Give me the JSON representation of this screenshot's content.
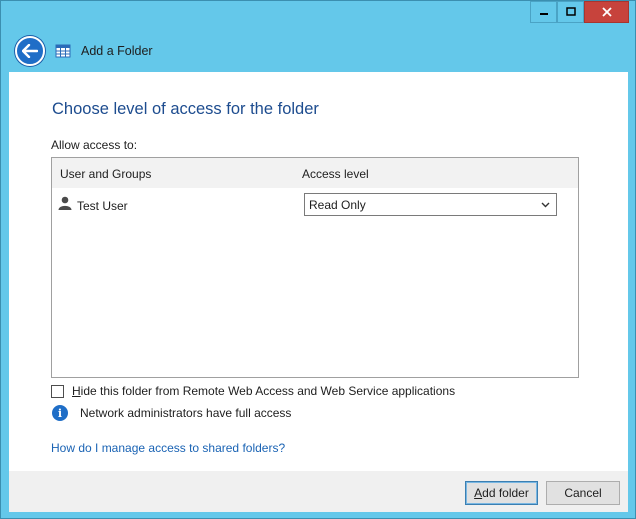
{
  "window": {
    "title": "Add a Folder",
    "caption_buttons": [
      "minimize",
      "maximize",
      "close"
    ]
  },
  "page": {
    "heading": "Choose level of access for the folder",
    "allow_label": "Allow access to:",
    "columns": [
      "User and Groups",
      "Access level"
    ],
    "rows": [
      {
        "name": "Test User",
        "access": "Read Only",
        "icon": "user-icon"
      }
    ],
    "hide_checkbox": {
      "label_prefix": "",
      "label_underlined": "H",
      "label_rest": "ide this folder from Remote Web Access and Web Service applications",
      "checked": false
    },
    "info_text": "Network administrators have full access",
    "help_link": "How do I manage access to shared folders?"
  },
  "footer": {
    "add_folder_underlined": "A",
    "add_folder_rest": "dd folder",
    "cancel": "Cancel"
  },
  "colors": {
    "frame": "#64c8ea",
    "heading": "#1d4c8f",
    "link": "#1a63b4",
    "accent": "#1f6ec7",
    "close": "#c7433c"
  }
}
